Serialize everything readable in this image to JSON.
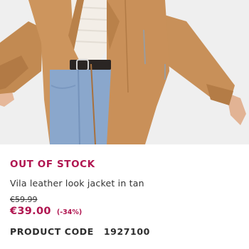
{
  "product": {
    "status": "OUT OF STOCK",
    "name": "Vila leather look jacket in tan",
    "old_price": "€59.99",
    "price": "€39.00",
    "discount": "(-34%)",
    "code_label": "PRODUCT CODE",
    "code_value": "1927100"
  },
  "colors": {
    "accent": "#b01550",
    "jacket": "#c8915a",
    "jeans": "#8aa7cc"
  }
}
